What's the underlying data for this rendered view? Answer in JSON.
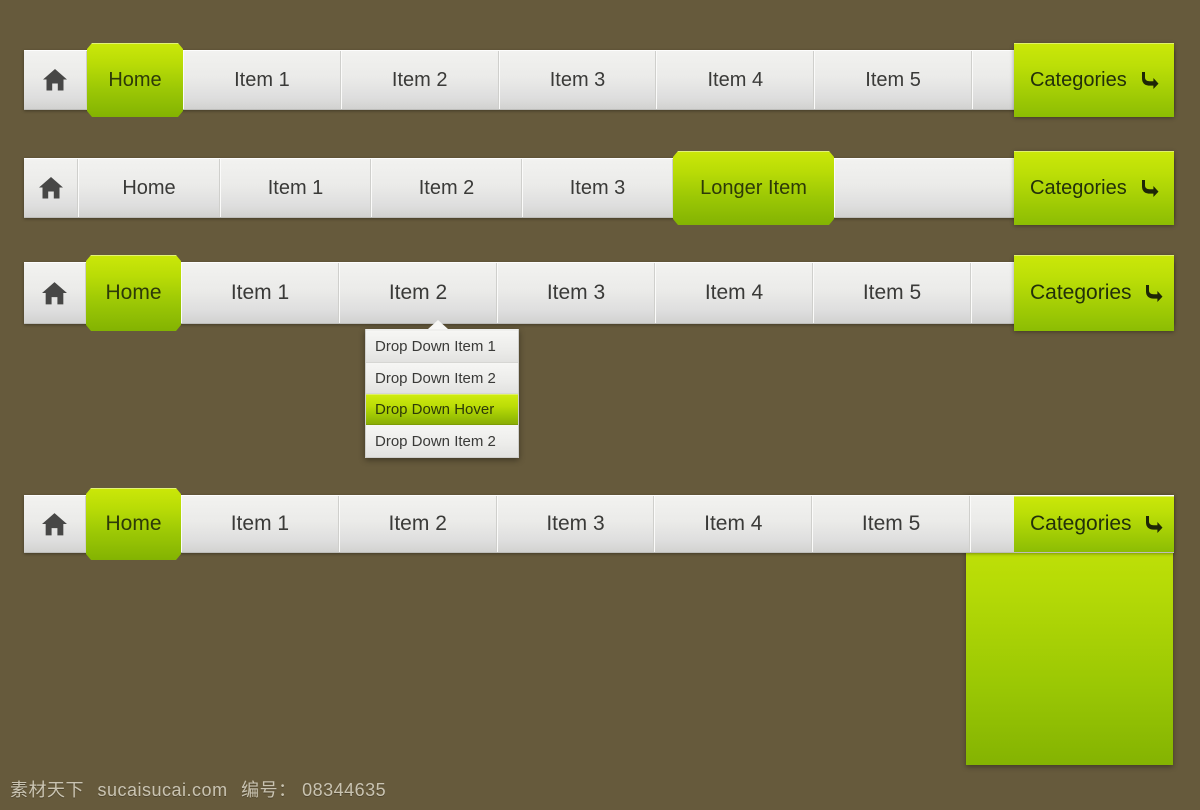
{
  "page": {
    "background_color": "#665a3c",
    "accent_green": "#b9dc06",
    "accent_green_light": "#cbe809",
    "bar_color": "#ebebe9",
    "text_color": "#3a3a38"
  },
  "icons": {
    "home": "home-icon",
    "categories_arrow": "curved-arrow-down-icon"
  },
  "navbars": [
    {
      "id": "navbar-1",
      "home_label": "",
      "items": [
        {
          "label": "Home",
          "state": "active"
        },
        {
          "label": "Item 1",
          "state": "normal"
        },
        {
          "label": "Item 2",
          "state": "normal"
        },
        {
          "label": "Item 3",
          "state": "normal"
        },
        {
          "label": "Item 4",
          "state": "normal"
        },
        {
          "label": "Item 5",
          "state": "normal"
        }
      ],
      "categories": {
        "label": "Categories",
        "open": false
      }
    },
    {
      "id": "navbar-2",
      "items": [
        {
          "label": "Home",
          "state": "normal"
        },
        {
          "label": "Item 1",
          "state": "normal"
        },
        {
          "label": "Item 2",
          "state": "normal"
        },
        {
          "label": "Item 3",
          "state": "normal"
        },
        {
          "label": "Longer Item",
          "state": "active"
        }
      ],
      "categories": {
        "label": "Categories",
        "open": false
      }
    },
    {
      "id": "navbar-3",
      "items": [
        {
          "label": "Home",
          "state": "active"
        },
        {
          "label": "Item 1",
          "state": "normal"
        },
        {
          "label": "Item 2",
          "state": "dropdown-open"
        },
        {
          "label": "Item 3",
          "state": "normal"
        },
        {
          "label": "Item 4",
          "state": "normal"
        },
        {
          "label": "Item 5",
          "state": "normal"
        }
      ],
      "categories": {
        "label": "Categories",
        "open": false
      },
      "dropdown": {
        "items": [
          {
            "label": "Drop Down Item 1",
            "state": "normal"
          },
          {
            "label": "Drop Down Item 2",
            "state": "normal"
          },
          {
            "label": "Drop Down Hover",
            "state": "hover"
          },
          {
            "label": "Drop Down Item 2",
            "state": "normal"
          }
        ]
      }
    },
    {
      "id": "navbar-4",
      "items": [
        {
          "label": "Home",
          "state": "active"
        },
        {
          "label": "Item 1",
          "state": "normal"
        },
        {
          "label": "Item 2",
          "state": "normal"
        },
        {
          "label": "Item 3",
          "state": "normal"
        },
        {
          "label": "Item 4",
          "state": "normal"
        },
        {
          "label": "Item 5",
          "state": "normal"
        }
      ],
      "categories": {
        "label": "Categories",
        "open": true
      }
    }
  ],
  "watermark": {
    "site_cn": "素材天下",
    "site_url": "sucaisucai.com",
    "id_label": "编号：",
    "id_value": "08344635"
  }
}
